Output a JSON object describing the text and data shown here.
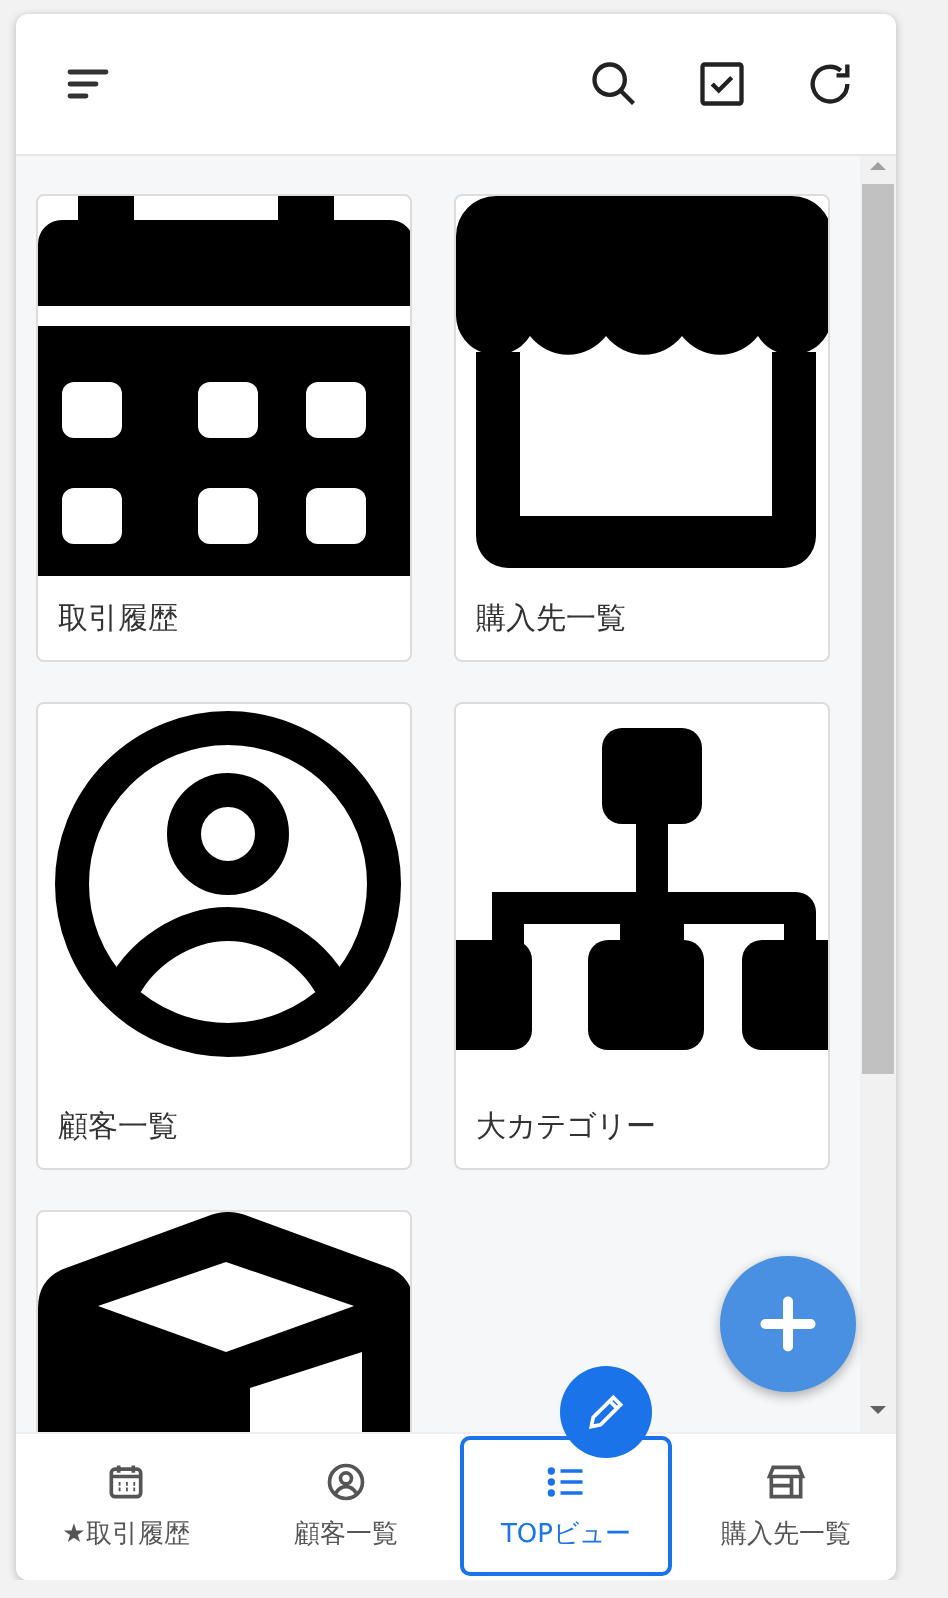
{
  "tiles": [
    {
      "kind": "calendar",
      "label": "取引履歴"
    },
    {
      "kind": "store",
      "label": "購入先一覧"
    },
    {
      "kind": "person",
      "label": "顧客一覧"
    },
    {
      "kind": "hierarchy",
      "label": "大カテゴリー"
    },
    {
      "kind": "box"
    }
  ],
  "nav": [
    {
      "kind": "calendar",
      "label": "★取引履歴",
      "selected": false
    },
    {
      "kind": "person",
      "label": "顧客一覧",
      "selected": false
    },
    {
      "kind": "list",
      "label": "TOPビュー",
      "selected": true
    },
    {
      "kind": "store",
      "label": "購入先一覧",
      "selected": false
    }
  ]
}
